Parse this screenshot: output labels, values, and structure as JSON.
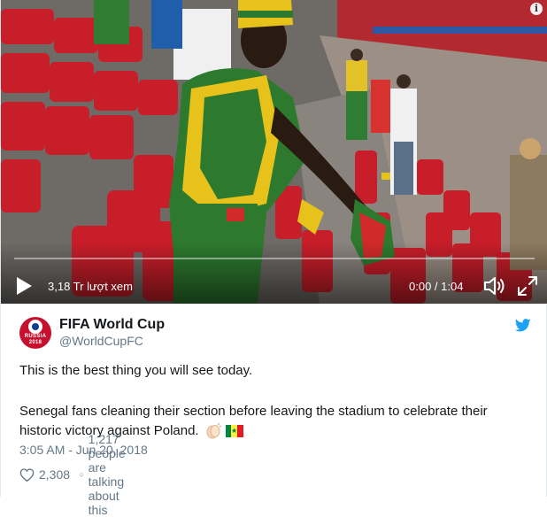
{
  "video": {
    "views": "3,18 Tr lượt xem",
    "time": "0:00 / 1:04",
    "progress": 0
  },
  "tweet": {
    "author_name": "FIFA World Cup",
    "author_handle": "@WorldCupFC",
    "avatar_text": "RUSSIA 2018",
    "line1": "This is the best thing you will see today.",
    "line2": "Senegal fans cleaning their section before leaving the stadium to celebrate their historic victory against Poland.",
    "timestamp": "3:05 AM - Jun 20, 2018",
    "likes": "2,308",
    "replies_text": "1,217 people are talking about this"
  },
  "icons": [
    "info-icon",
    "play-icon",
    "volume-icon",
    "fullscreen-icon",
    "twitter-bird-icon",
    "clapping-hands-emoji",
    "senegal-flag-emoji",
    "heart-icon",
    "reply-bubble-icon"
  ],
  "colors": {
    "brand_blue": "#1da1f2",
    "secondary_text": "#657786",
    "seat_red": "#c81e2a"
  }
}
